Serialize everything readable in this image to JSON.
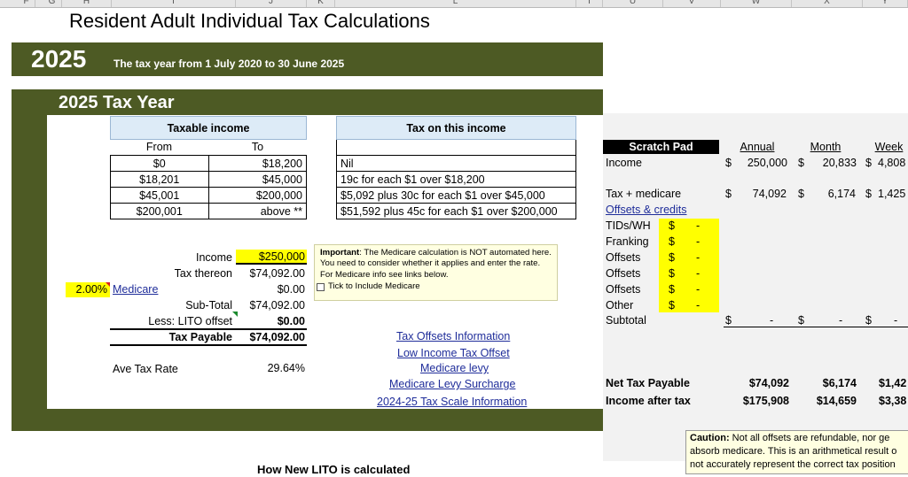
{
  "colors": {
    "header_green": "#4d5a24",
    "table_header_blue": "#ddebf7",
    "highlight_yellow": "#ffff00",
    "link_blue": "#1f2d9a",
    "note_yellow": "#ffffe1"
  },
  "columns": [
    "F",
    "G",
    "H",
    "I",
    "J",
    "K",
    "L",
    "T",
    "U",
    "V",
    "W",
    "X",
    "Y"
  ],
  "sheet_title": "Resident Adult Individual Tax Calculations",
  "banner": {
    "year": "2025",
    "subtitle": "The tax year from 1 July 2020 to 30 June 2025"
  },
  "panel_title": "2025 Tax Year",
  "taxable_income": {
    "header": "Taxable income",
    "col_from": "From",
    "col_to": "To",
    "rows": [
      {
        "from": "$0",
        "to": "$18,200"
      },
      {
        "from": "$18,201",
        "to": "$45,000"
      },
      {
        "from": "$45,001",
        "to": "$200,000"
      },
      {
        "from": "$200,001",
        "to": "above **"
      }
    ]
  },
  "tax_on_income": {
    "header": "Tax on this income",
    "rows": [
      "Nil",
      "19c for each $1 over $18,200",
      "$5,092 plus 30c for each $1 over $45,000",
      "$51,592 plus 45c for each $1 over $200,000"
    ]
  },
  "calc": {
    "income_label": "Income",
    "income_value": "$250,000",
    "tax_thereon_label": "Tax thereon",
    "tax_thereon_value": "$74,092.00",
    "medicare_rate": "2.00%",
    "medicare_label": "Medicare",
    "medicare_value": "$0.00",
    "subtotal_label": "Sub-Total",
    "subtotal_value": "$74,092.00",
    "lito_label": "Less: LITO offset",
    "lito_value": "$0.00",
    "payable_label": "Tax Payable",
    "payable_value": "$74,092.00",
    "ave_rate_label": "Ave Tax Rate",
    "ave_rate_value": "29.64%"
  },
  "note": {
    "lead": "Important",
    "text": ": The Medicare calculation is  NOT automated here.  You need to consider whether it applies and enter the rate.  For Medicare info see links below.",
    "checkbox_label": "Tick to Include Medicare"
  },
  "links": [
    "Tax Offsets Information",
    "Low Income Tax Offset",
    "Medicare levy",
    "Medicare Levy Surcharge",
    "2024-25 Tax Scale Information"
  ],
  "footer_heading": "How New LITO is calculated",
  "scratch": {
    "title": "Scratch Pad",
    "headers": [
      "Annual",
      "Month",
      "Week"
    ],
    "income_label": "Income",
    "income": [
      "250,000",
      "20,833",
      "4,808"
    ],
    "taxmed_label": "Tax + medicare",
    "taxmed": [
      "74,092",
      "6,174",
      "1,425"
    ],
    "offsets_heading": "Offsets & credits",
    "offset_rows": [
      "TIDs/WH",
      "Franking",
      "Offsets",
      "Offsets",
      "Offsets",
      "Other"
    ],
    "currency": "$",
    "dash": "-",
    "subtotal_label": "Subtotal",
    "net_label": "Net Tax Payable",
    "net": [
      "$74,092",
      "$6,174",
      "$1,42"
    ],
    "after_label": "Income after tax",
    "after": [
      "$175,908",
      "$14,659",
      "$3,38"
    ]
  },
  "caution": {
    "lead": "Caution:",
    "text": " Not all offsets are refundable, nor ge absorb medicare. This is an arithmetical result o not accurately represent the correct tax position"
  }
}
